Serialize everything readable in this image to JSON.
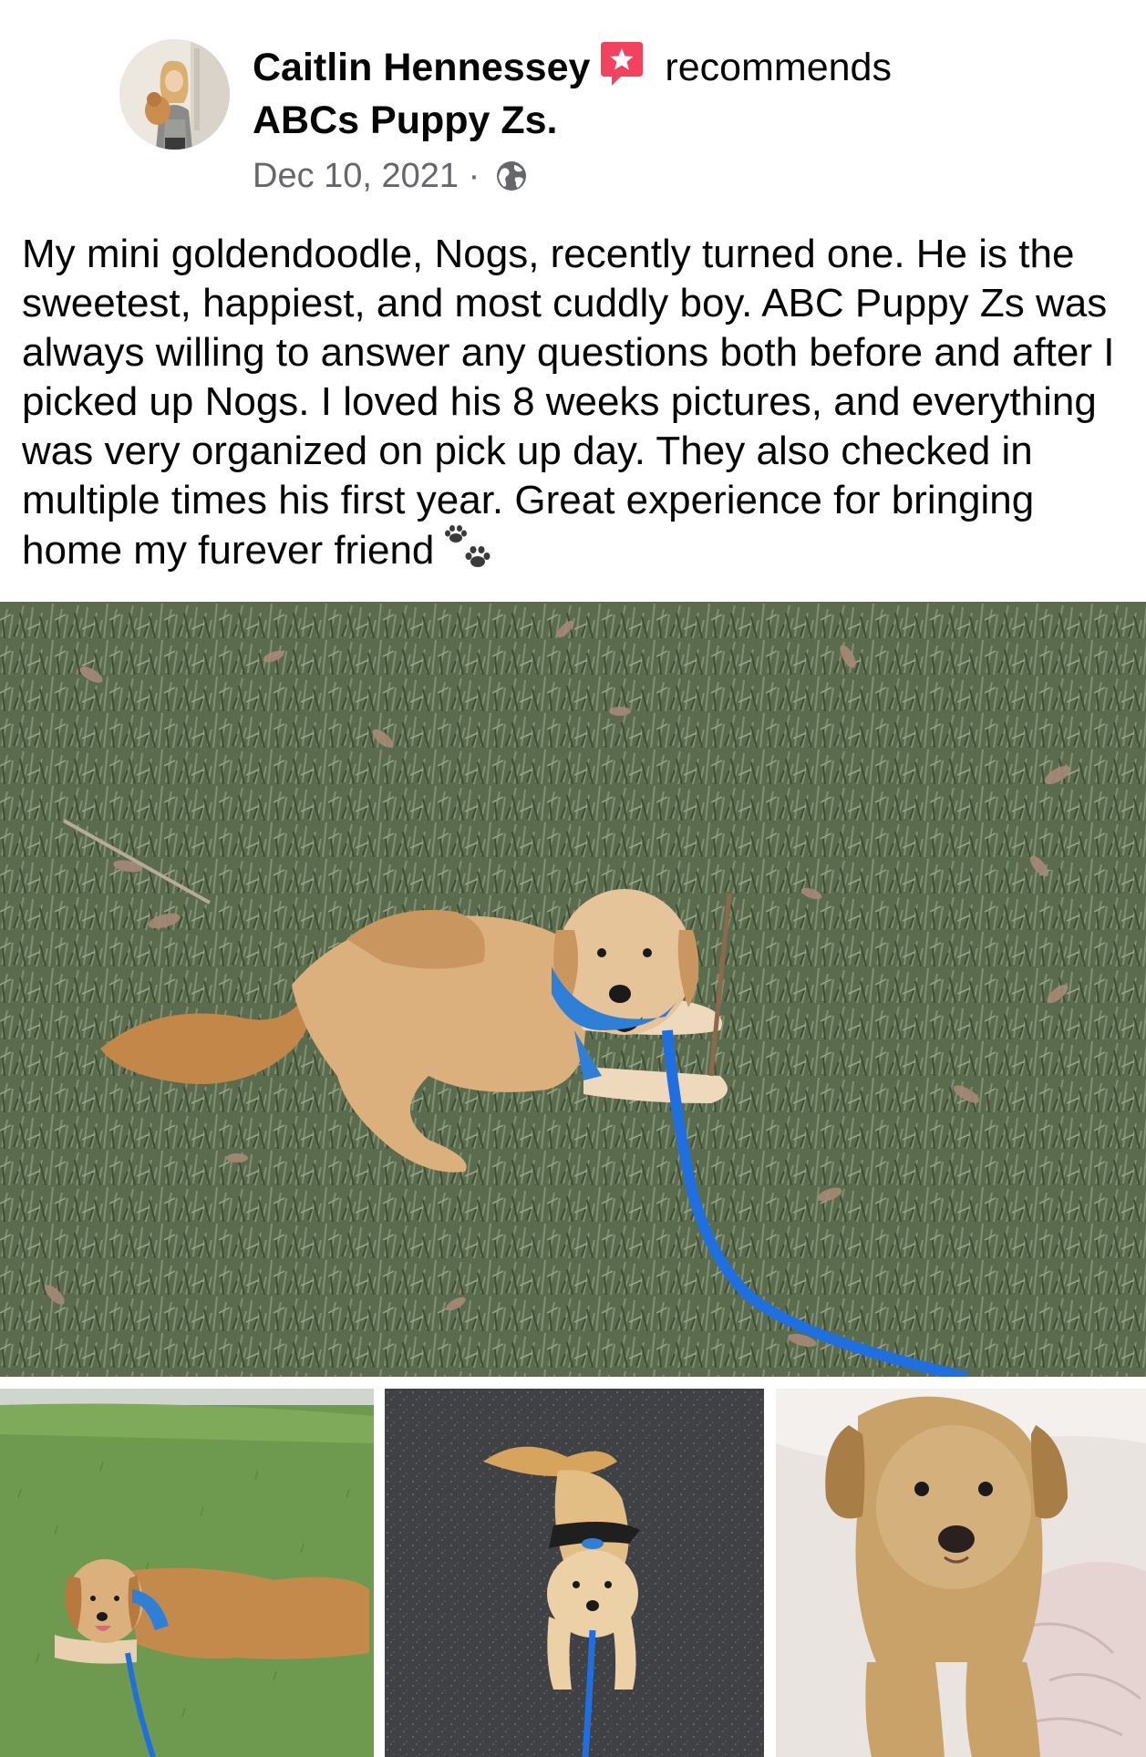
{
  "post": {
    "author_name": "Caitlin Hennessey",
    "recommends_label": "recommends",
    "page_name": "ABCs Puppy Zs.",
    "date": "Dec 10, 2021",
    "separator": "·",
    "privacy_icon": "globe-icon",
    "badge_icon": "recommendation-star-icon",
    "body_text": "My mini goldendoodle, Nogs, recently turned one. He is the sweetest, happiest, and most cuddly boy. ABC Puppy Zs was always willing to answer any questions both before and after I picked up Nogs. I loved his 8 weeks pictures, and everything was very organized on pick up day. They also checked in multiple times his first year. Great experience for bringing home my furever friend",
    "trailing_emoji": "paw-prints-icon"
  },
  "colors": {
    "badge_red": "#f3425f",
    "meta_gray": "#65676b",
    "text": "#050505",
    "leash_blue": "#1f6fe0"
  },
  "photos": [
    {
      "id": "main",
      "subject": "goldendoodle lying on grass with stick and blue leash"
    },
    {
      "id": "thumb-1",
      "subject": "goldendoodle lying on green lawn"
    },
    {
      "id": "thumb-2",
      "subject": "goldendoodle on dark rubber floor"
    },
    {
      "id": "thumb-3",
      "subject": "goldendoodle on bed with pink blanket"
    }
  ]
}
